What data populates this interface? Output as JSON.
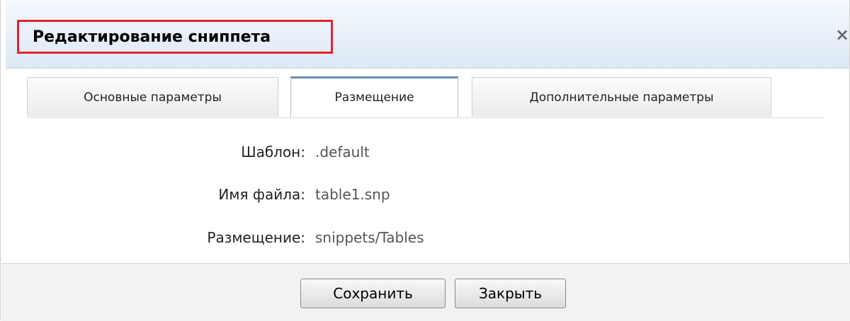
{
  "dialog": {
    "title": "Редактирование сниппета",
    "close_symbol": "×"
  },
  "tabs": [
    {
      "label": "Основные параметры",
      "active": false
    },
    {
      "label": "Размещение",
      "active": true
    },
    {
      "label": "Дополнительные параметры",
      "active": false
    }
  ],
  "fields": [
    {
      "label": "Шаблон:",
      "value": ".default"
    },
    {
      "label": "Имя файла:",
      "value": "table1.snp"
    },
    {
      "label": "Размещение:",
      "value": "snippets/Tables"
    }
  ],
  "buttons": {
    "save_label": "Сохранить",
    "close_label": "Закрыть"
  },
  "colors": {
    "highlight": "#e4232a",
    "active_tab_accent": "#6a8fb3",
    "titlebar": "#dde9f6"
  },
  "icons": {
    "close": "close-icon"
  }
}
